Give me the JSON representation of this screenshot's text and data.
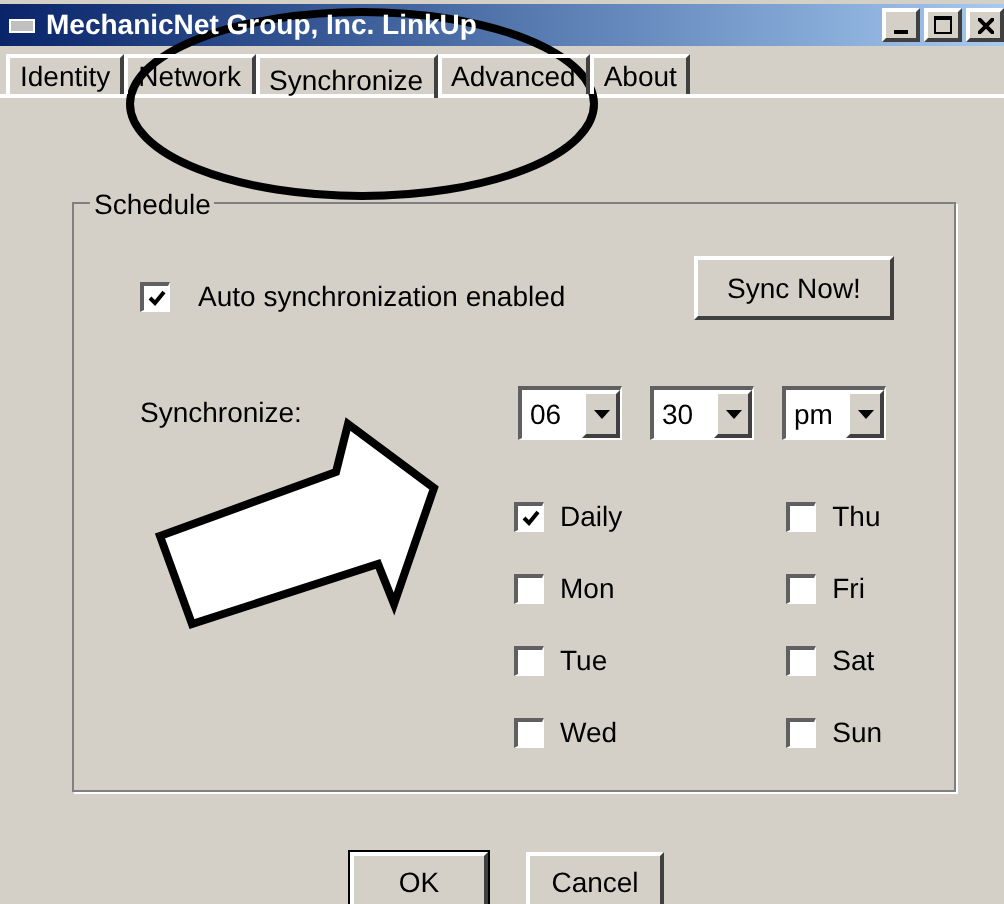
{
  "window": {
    "title": "MechanicNet Group, Inc. LinkUp"
  },
  "tabs": [
    {
      "label": "Identity",
      "selected": false
    },
    {
      "label": "Network",
      "selected": false
    },
    {
      "label": "Synchronize",
      "selected": true
    },
    {
      "label": "Advanced",
      "selected": false
    },
    {
      "label": "About",
      "selected": false
    }
  ],
  "schedule": {
    "title": "Schedule",
    "auto_sync": {
      "label": "Auto synchronization enabled",
      "checked": true
    },
    "sync_now_button": "Sync Now!",
    "synchronize_label": "Synchronize:",
    "time": [
      {
        "value": "06"
      },
      {
        "value": "30"
      },
      {
        "value": "pm"
      }
    ],
    "days": [
      {
        "label": "Daily",
        "checked": true
      },
      {
        "label": "Mon",
        "checked": false
      },
      {
        "label": "Tue",
        "checked": false
      },
      {
        "label": "Wed",
        "checked": false
      },
      {
        "label": "Thu",
        "checked": false
      },
      {
        "label": "Fri",
        "checked": false
      },
      {
        "label": "Sat",
        "checked": false
      },
      {
        "label": "Sun",
        "checked": false
      }
    ]
  },
  "buttons": [
    "OK",
    "Cancel"
  ]
}
